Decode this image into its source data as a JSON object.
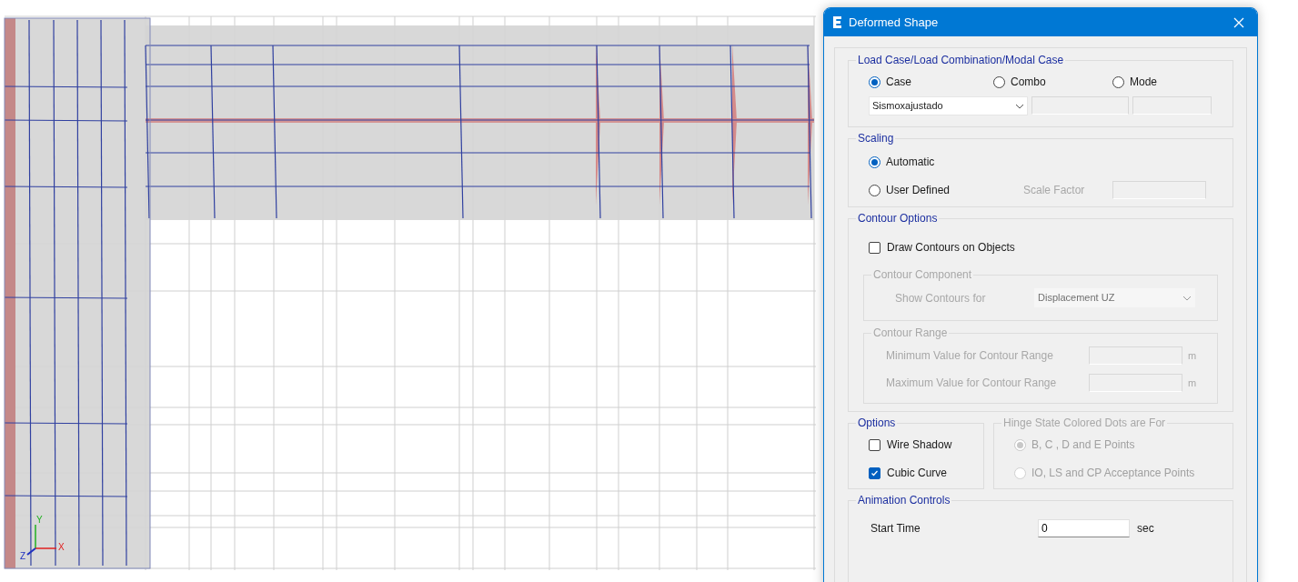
{
  "viewport": {
    "axes": [
      {
        "label": "X",
        "kind": "x"
      },
      {
        "label": "Y",
        "kind": "y"
      },
      {
        "label": "Z",
        "kind": "z"
      }
    ]
  },
  "dialog": {
    "title": "Deformed Shape",
    "load_case": {
      "legend": "Load Case/Load Combination/Modal Case",
      "options": [
        {
          "label": "Case",
          "selected": true
        },
        {
          "label": "Combo",
          "selected": false
        },
        {
          "label": "Mode",
          "selected": false
        }
      ],
      "case_value": "Sismoxajustado"
    },
    "scaling": {
      "legend": "Scaling",
      "options": [
        {
          "label": "Automatic",
          "selected": true
        },
        {
          "label": "User Defined",
          "selected": false
        }
      ],
      "scale_factor_label": "Scale Factor",
      "scale_factor_disabled": true
    },
    "contour_options": {
      "legend": "Contour Options",
      "draw_contours": {
        "label": "Draw Contours on Objects",
        "checked": false
      },
      "component": {
        "legend": "Contour Component",
        "disabled": true,
        "label": "Show Contours for",
        "value": "Displacement UZ"
      },
      "range": {
        "legend": "Contour Range",
        "disabled": true,
        "rows": [
          {
            "label": "Minimum Value for Contour Range",
            "unit": "m"
          },
          {
            "label": "Maximum Value for Contour Range",
            "unit": "m"
          }
        ]
      }
    },
    "options": {
      "legend": "Options",
      "checkboxes": [
        {
          "label": "Wire Shadow",
          "checked": false
        },
        {
          "label": "Cubic Curve",
          "checked": true
        }
      ]
    },
    "hinge_state": {
      "legend": "Hinge State Colored Dots are For",
      "disabled": true,
      "options": [
        {
          "label": "B, C , D and E Points",
          "selected": true
        },
        {
          "label": "IO, LS and CP Acceptance Points",
          "selected": false
        }
      ]
    },
    "animation": {
      "legend": "Animation Controls",
      "start_time": {
        "label": "Start Time",
        "value": "0",
        "unit": "sec"
      }
    }
  }
}
